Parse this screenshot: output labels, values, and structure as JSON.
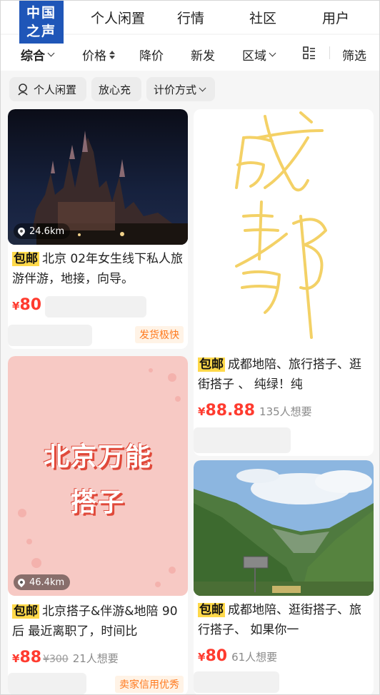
{
  "logo": {
    "line1": "中国",
    "line2": "之声"
  },
  "top_nav": {
    "tabs": [
      "个人闲置",
      "行情",
      "社区",
      "用户"
    ]
  },
  "filters": {
    "comprehensive": "综合",
    "price": "价格",
    "price_drop": "降价",
    "new": "新发",
    "region": "区域",
    "filter": "筛选",
    "layout_icon": "grid-list-icon"
  },
  "chips": [
    {
      "label": "个人闲置",
      "icon": "person-icon"
    },
    {
      "label": "放心充"
    },
    {
      "label": "计价方式"
    }
  ],
  "cards": [
    {
      "image": "castle-night-photo",
      "distance": "24.6km",
      "badge": "包邮",
      "title": "北京 02年女生线下私人旅游伴游，地接，向导。",
      "price_symbol": "¥",
      "price": "80",
      "tag": "发货极快"
    },
    {
      "image": "chengdu-handwriting",
      "image_text": "成都",
      "badge": "包邮",
      "title": "成都地陪、旅行搭子、逛街搭子 、 纯绿！纯",
      "price_symbol": "¥",
      "price": "88.88",
      "want": "135人想要"
    },
    {
      "image": "pink-poster",
      "image_text_1": "北京万能",
      "image_text_2": "搭子",
      "distance": "46.4km",
      "badge": "包邮",
      "title": "北京搭子&伴游&地陪 90后 最近离职了，时间比",
      "price_symbol": "¥",
      "price": "88",
      "original_price": "¥300",
      "want": "21人想要",
      "tag": "卖家信用优秀"
    },
    {
      "image": "mountain-valley-photo",
      "badge": "包邮",
      "title": "成都地陪、逛街搭子、旅行搭子、 如果你一",
      "price_symbol": "¥",
      "price": "80",
      "want": "61人想要"
    }
  ],
  "colors": {
    "accent_price": "#ff3b2f",
    "badge_yellow": "#ffd94a",
    "logo_blue": "#1f56b8",
    "tag_orange": "#ff7a1f"
  }
}
